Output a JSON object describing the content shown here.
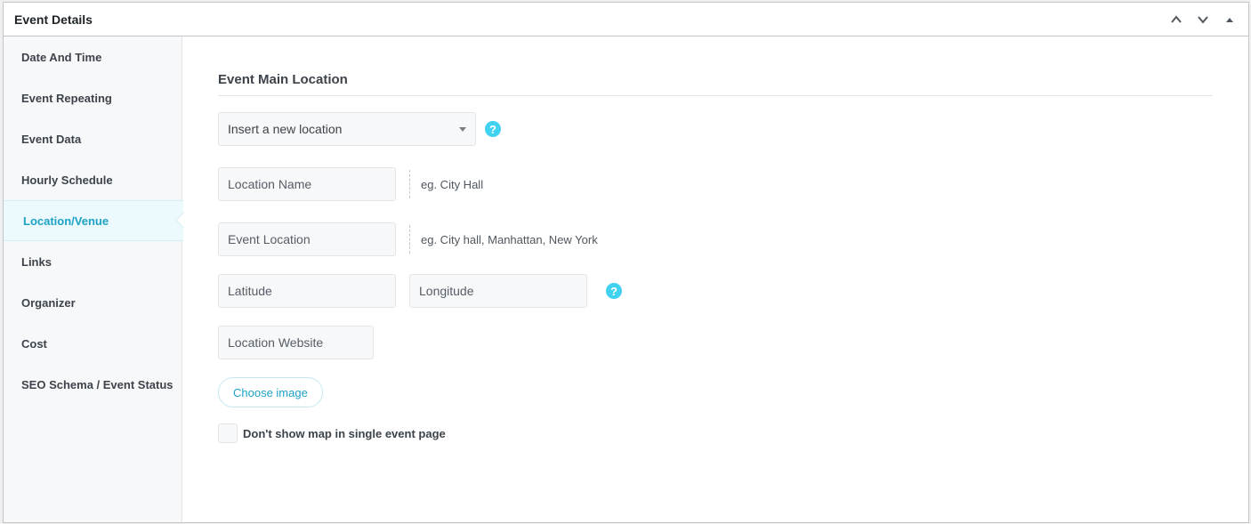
{
  "header": {
    "title": "Event Details"
  },
  "sidebar": {
    "items": [
      {
        "label": "Date And Time"
      },
      {
        "label": "Event Repeating"
      },
      {
        "label": "Event Data"
      },
      {
        "label": "Hourly Schedule"
      },
      {
        "label": "Location/Venue",
        "active": true
      },
      {
        "label": "Links"
      },
      {
        "label": "Organizer"
      },
      {
        "label": "Cost"
      },
      {
        "label": "SEO Schema / Event Status"
      }
    ]
  },
  "location": {
    "section_title": "Event Main Location",
    "select_value": "Insert a new location",
    "help_glyph": "?",
    "location_name_placeholder": "Location Name",
    "location_name_hint": "eg. City Hall",
    "event_location_placeholder": "Event Location",
    "event_location_hint": "eg. City hall, Manhattan, New York",
    "latitude_placeholder": "Latitude",
    "longitude_placeholder": "Longitude",
    "website_placeholder": "Location Website",
    "choose_image_label": "Choose image",
    "hide_map_label": "Don't show map in single event page",
    "hide_map_checked": false
  },
  "colors": {
    "accent": "#1ea2c4",
    "help_icon": "#40d2f0",
    "active_bg": "#ecf9fd"
  },
  "icons": {
    "move_up": "chevron-up-icon",
    "move_down": "chevron-down-icon",
    "toggle": "triangle-up-icon",
    "help": "question-circle-icon"
  }
}
